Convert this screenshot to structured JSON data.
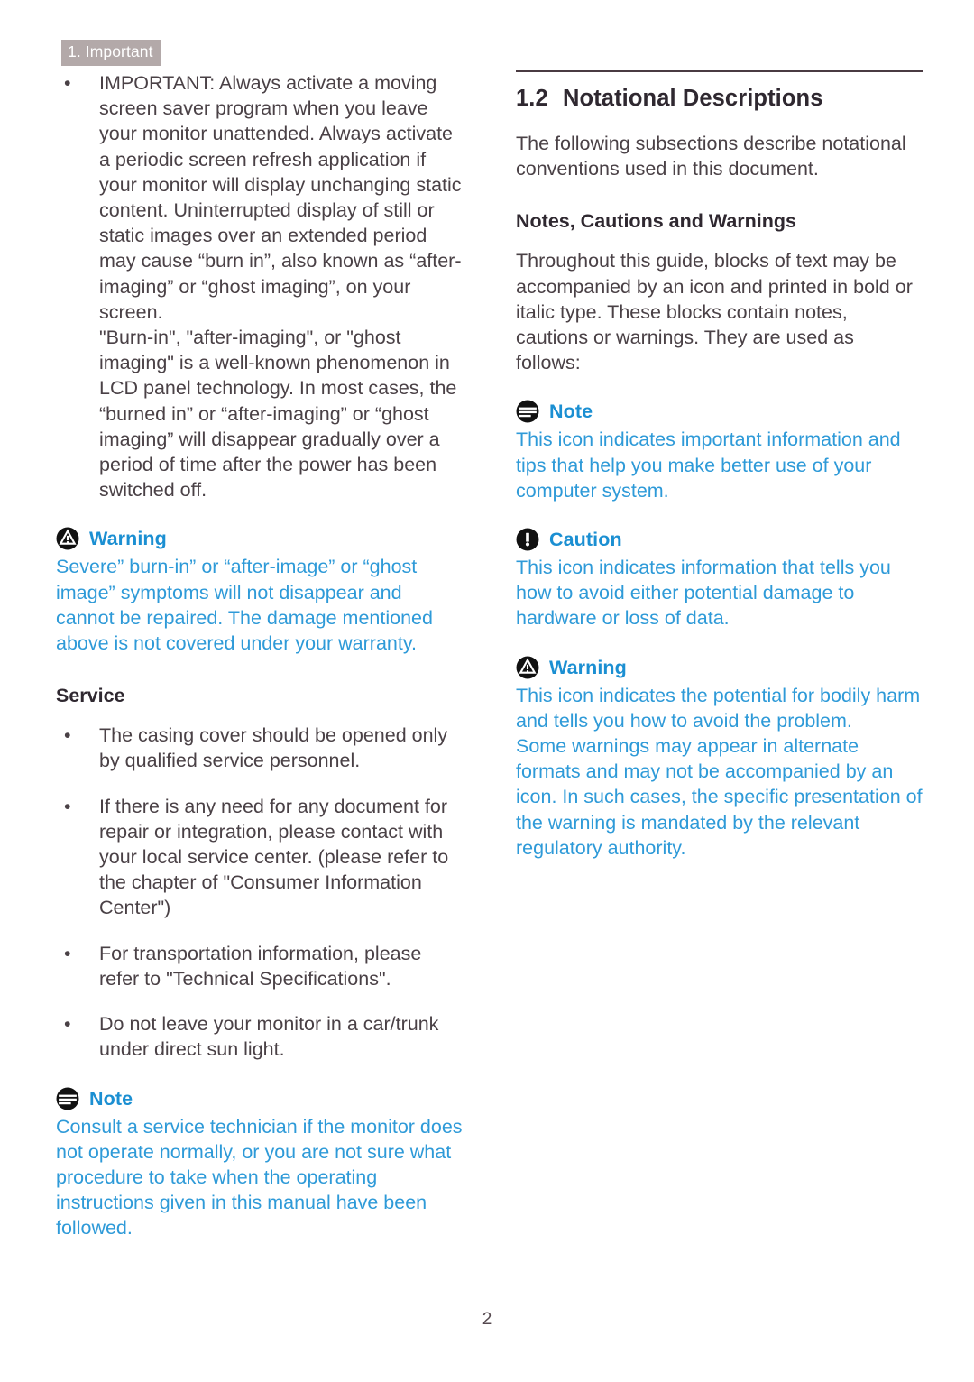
{
  "running_header": "1. Important",
  "page_number": "2",
  "colors": {
    "header_bg": "#b3a9a9",
    "callout_blue": "#2e9ad8",
    "callout_head_blue": "#1b8fd2",
    "body_text": "#4a4146",
    "rule": "#4a3b42"
  },
  "left_column": {
    "bullets": [
      {
        "text": "IMPORTANT: Always activate a moving screen saver program when you leave your monitor unattended. Always activate a periodic screen refresh application if your monitor will display unchanging static content. Uninterrupted display of still or static images over an extended period may cause “burn in”, also known as “after-imaging” or “ghost imaging”, on your screen.",
        "continuation": "\"Burn-in\", \"after-imaging\", or \"ghost imaging\" is a well-known phenomenon in LCD panel technology. In most cases, the “burned in” or “after-imaging” or “ghost imaging” will disappear gradually over a period of time after the power has been switched off."
      }
    ],
    "warning_callout": {
      "icon": "warning-triangle-icon",
      "label": "Warning",
      "body": "Severe” burn-in” or “after-image” or “ghost image” symptoms will not disappear and cannot be repaired. The damage mentioned above is not covered under your warranty."
    },
    "service_heading": "Service",
    "service_bullets": [
      "The casing cover should be opened only by qualified service personnel.",
      "If there is any need for any document for repair or integration, please contact with your local service center. (please refer to the chapter of \"Consumer Information Center\")",
      "For transportation information, please refer to \"Technical Specifications\".",
      "Do not leave your monitor in a car/trunk under direct sun light."
    ],
    "note_callout": {
      "icon": "note-lines-icon",
      "label": "Note",
      "body": "Consult a service technician if the monitor does not operate normally, or you are not sure what procedure to take when the operating instructions given in this manual have been followed."
    }
  },
  "right_column": {
    "section_number": "1.2",
    "section_title": "Notational Descriptions",
    "intro": "The following subsections describe notational conventions used in this document.",
    "sub_heading": "Notes, Cautions and Warnings",
    "sub_intro": "Throughout this guide, blocks of text may be accompanied by an icon and printed in bold or italic type. These blocks contain notes, cautions or warnings. They are used as follows:",
    "callouts": [
      {
        "icon": "note-lines-icon",
        "label": "Note",
        "body": "This icon indicates important information and tips that help you make better use of your computer system."
      },
      {
        "icon": "caution-exclamation-icon",
        "label": "Caution",
        "body": "This icon indicates information that tells you how to avoid either potential damage to hardware or loss of data."
      },
      {
        "icon": "warning-triangle-icon",
        "label": "Warning",
        "body": "This icon indicates the potential for bodily harm and tells you how to avoid the problem.",
        "body2": "Some warnings may appear in alternate formats and may not be accompanied by an icon. In such cases, the specific presentation of the warning is mandated by the relevant regulatory authority."
      }
    ]
  }
}
